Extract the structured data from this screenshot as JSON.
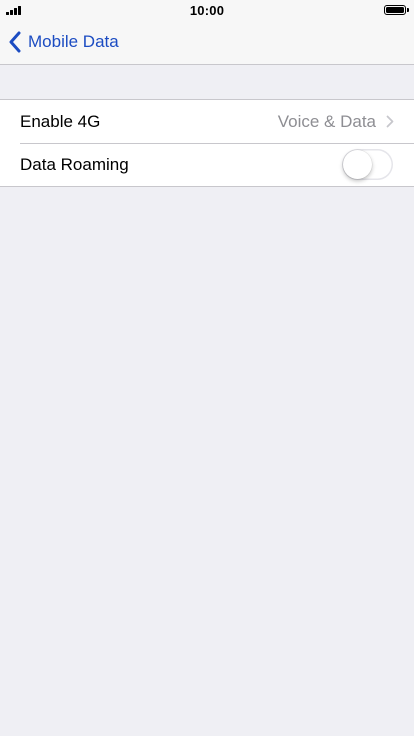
{
  "status_bar": {
    "time": "10:00"
  },
  "nav": {
    "back_label": "Mobile Data"
  },
  "settings": {
    "rows": [
      {
        "label": "Enable 4G",
        "value": "Voice & Data"
      },
      {
        "label": "Data Roaming",
        "toggle_on": false
      }
    ]
  },
  "colors": {
    "accent": "#1c4cc2",
    "background": "#efeff4",
    "secondary_text": "#8e8e93",
    "separator": "#c8c7cc"
  },
  "icons": {
    "signal": "signal-strength-icon",
    "battery": "battery-icon",
    "back": "chevron-left-icon",
    "disclosure": "chevron-right-icon"
  }
}
